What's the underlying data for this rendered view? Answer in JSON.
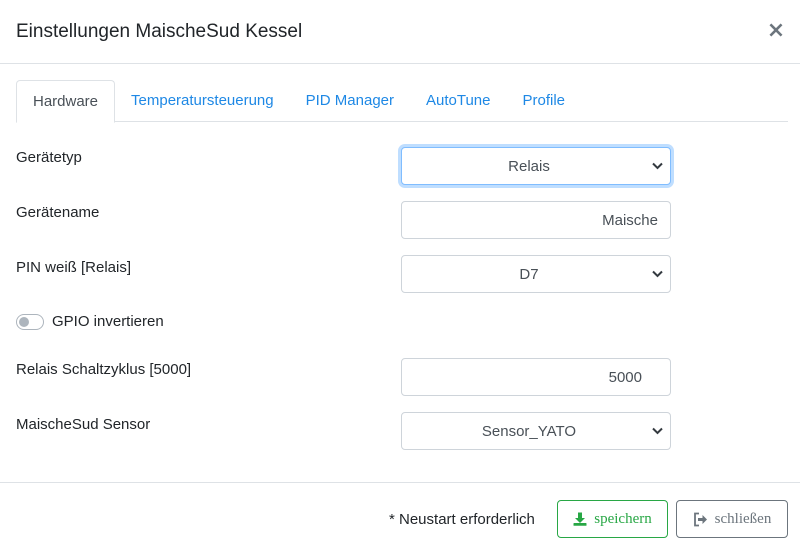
{
  "header": {
    "title": "Einstellungen MaischeSud Kessel",
    "close_glyph": "×"
  },
  "tabs": [
    {
      "label": "Hardware",
      "active": true
    },
    {
      "label": "Temperatursteuerung",
      "active": false
    },
    {
      "label": "PID Manager",
      "active": false
    },
    {
      "label": "AutoTune",
      "active": false
    },
    {
      "label": "Profile",
      "active": false
    }
  ],
  "form": {
    "device_type": {
      "label": "Gerätetyp",
      "value": "Relais"
    },
    "device_name": {
      "label": "Gerätename",
      "value": "Maische"
    },
    "pin": {
      "label": "PIN weiß [Relais]",
      "value": "D7"
    },
    "gpio_invert": {
      "label": "GPIO invertieren",
      "checked": false
    },
    "relay_cycle": {
      "label": "Relais Schaltzyklus [5000]",
      "value": "5000"
    },
    "sensor": {
      "label": "MaischeSud Sensor",
      "value": "Sensor_YATO"
    }
  },
  "footer": {
    "note": "* Neustart erforderlich",
    "save_label": "speichern",
    "close_label": "schließen"
  },
  "icons": {
    "close": "close-icon",
    "select_arrow": "chevron-down-icon",
    "save": "download-icon",
    "close_button": "sign-out-icon"
  },
  "colors": {
    "tab_link": "#1e88e5",
    "save_green": "#28a745",
    "close_gray": "#6c757d",
    "focus_blue": "#80bdff"
  }
}
